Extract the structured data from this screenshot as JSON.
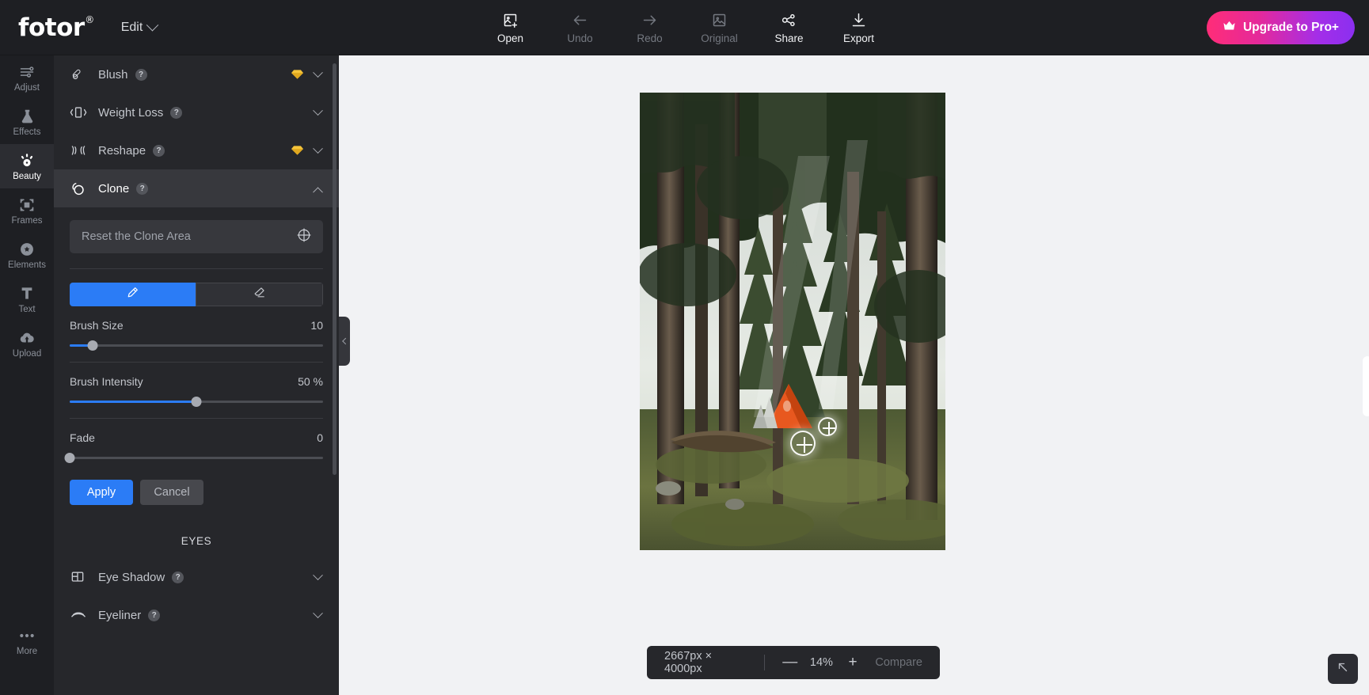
{
  "brand": {
    "name": "fotor",
    "registered": "®"
  },
  "header": {
    "edit_label": "Edit",
    "upgrade_label": "Upgrade to Pro+",
    "upgrade_icon": "crown-icon",
    "tools": [
      {
        "label": "Open",
        "icon": "open-image-icon",
        "state": "enabled"
      },
      {
        "label": "Undo",
        "icon": "arrow-left-icon",
        "state": "disabled"
      },
      {
        "label": "Redo",
        "icon": "arrow-right-icon",
        "state": "disabled"
      },
      {
        "label": "Original",
        "icon": "image-icon",
        "state": "disabled"
      },
      {
        "label": "Share",
        "icon": "share-nodes-icon",
        "state": "enabled"
      },
      {
        "label": "Export",
        "icon": "download-icon",
        "state": "enabled"
      }
    ]
  },
  "sidebar": {
    "items": [
      {
        "label": "Adjust",
        "icon": "sliders-icon",
        "active": false
      },
      {
        "label": "Effects",
        "icon": "flask-icon",
        "active": false
      },
      {
        "label": "Beauty",
        "icon": "eye-icon",
        "active": true
      },
      {
        "label": "Frames",
        "icon": "frame-icon",
        "active": false
      },
      {
        "label": "Elements",
        "icon": "star-icon",
        "active": false
      },
      {
        "label": "Text",
        "icon": "text-t-icon",
        "active": false
      },
      {
        "label": "Upload",
        "icon": "upload-icon",
        "active": false
      }
    ],
    "more": {
      "label": "More",
      "icon": "ellipsis-icon"
    }
  },
  "panel": {
    "items_top": [
      {
        "label": "Blush",
        "icon": "blush-icon",
        "help": "?",
        "premium": true,
        "expanded": false
      },
      {
        "label": "Weight Loss",
        "icon": "weightloss-icon",
        "help": "?",
        "premium": false,
        "expanded": false
      },
      {
        "label": "Reshape",
        "icon": "reshape-icon",
        "help": "?",
        "premium": true,
        "expanded": false
      },
      {
        "label": "Clone",
        "icon": "clone-icon",
        "help": "?",
        "premium": false,
        "expanded": true
      }
    ],
    "clone": {
      "reset_label": "Reset the Clone Area",
      "reset_icon": "target-crosshair-icon",
      "brush_tool_icon": "pencil-icon",
      "eraser_tool_icon": "eraser-icon",
      "brush_tool_active": true,
      "sliders": [
        {
          "label": "Brush Size",
          "value": "10",
          "percent": 9,
          "unit": ""
        },
        {
          "label": "Brush Intensity",
          "value": "50",
          "percent": 50,
          "unit": "%"
        },
        {
          "label": "Fade",
          "value": "0",
          "percent": 0,
          "unit": ""
        }
      ],
      "apply_label": "Apply",
      "cancel_label": "Cancel"
    },
    "section_eyes": "EYES",
    "items_eyes": [
      {
        "label": "Eye Shadow",
        "icon": "eyeshadow-icon",
        "help": "?",
        "premium": false,
        "expanded": false
      },
      {
        "label": "Eyeliner",
        "icon": "eyeliner-icon",
        "help": "?",
        "premium": false,
        "expanded": false
      }
    ],
    "collapse_icon": "chevron-left-icon"
  },
  "canvas": {
    "zoombar": {
      "dimensions": "2667px × 4000px",
      "zoom_out": "—",
      "zoom_level": "14%",
      "zoom_in": "+",
      "compare_label": "Compare"
    },
    "corner_icon": "expand-arrow-icon",
    "clone_markers": [
      {
        "name": "clone-destination-marker",
        "size": 30
      },
      {
        "name": "clone-source-marker",
        "size": 22
      }
    ]
  },
  "colors": {
    "accent_blue": "#2b7cf6",
    "premium_gold": "#f5c43a",
    "upgrade_start": "#ff2d78",
    "upgrade_end": "#8b2ff0",
    "panel_bg": "#26272b",
    "canvas_bg": "#f1f2f4"
  }
}
